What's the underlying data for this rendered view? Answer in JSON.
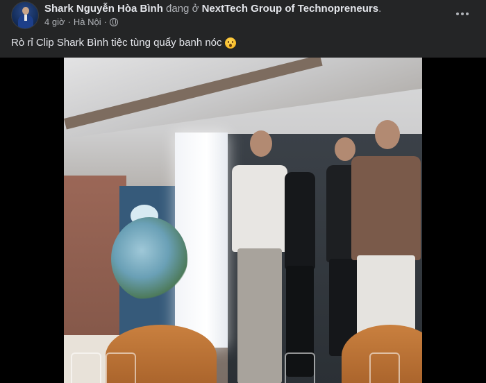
{
  "post": {
    "author": "Shark Nguyễn Hòa Bình",
    "at_text": "đang ở",
    "group": "NextTech Group of Technopreneurs",
    "group_suffix": ".",
    "time": "4 giờ",
    "separator": "·",
    "location": "Hà Nội",
    "separator2": "·",
    "privacy_icon": "globe-icon",
    "caption": "Rò rỉ Clip Shark Bình tiệc tùng quẩy banh nóc",
    "caption_emoji": "astonished-face-emoji"
  },
  "header": {
    "more_icon": "more-horizontal-icon"
  },
  "colors": {
    "background": "#242526",
    "text_primary": "#e4e6eb",
    "text_secondary": "#b0b3b8",
    "video_letterbox": "#000000"
  }
}
